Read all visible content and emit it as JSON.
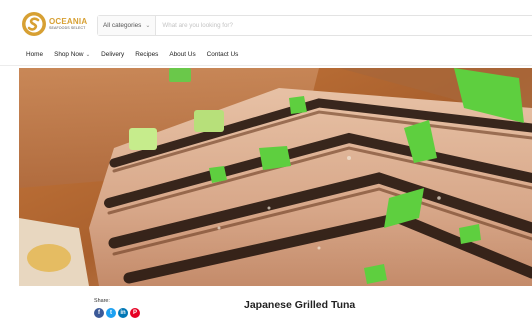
{
  "header": {
    "logo": {
      "name": "OCEANIA",
      "sub": "SEAFOODS SELECT"
    },
    "search": {
      "category_label": "All categories",
      "placeholder": "What are you looking for?"
    }
  },
  "nav": {
    "items": [
      {
        "label": "Home",
        "has_dropdown": false
      },
      {
        "label": "Shop Now",
        "has_dropdown": true
      },
      {
        "label": "Delivery",
        "has_dropdown": false
      },
      {
        "label": "Recipes",
        "has_dropdown": false
      },
      {
        "label": "About Us",
        "has_dropdown": false
      },
      {
        "label": "Contact Us",
        "has_dropdown": false
      }
    ]
  },
  "hero": {
    "image": "grilled-tuna-steak-photo"
  },
  "share": {
    "label": "Share:",
    "buttons": [
      {
        "network": "facebook",
        "glyph": "f",
        "color": "#3b5998"
      },
      {
        "network": "twitter",
        "glyph": "t",
        "color": "#1da1f2"
      },
      {
        "network": "linkedin",
        "glyph": "in",
        "color": "#0077b5"
      },
      {
        "network": "pinterest",
        "glyph": "P",
        "color": "#e60023"
      }
    ]
  },
  "recipe": {
    "title": "Japanese Grilled Tuna"
  },
  "colors": {
    "brand_gold": "#d7a033"
  }
}
